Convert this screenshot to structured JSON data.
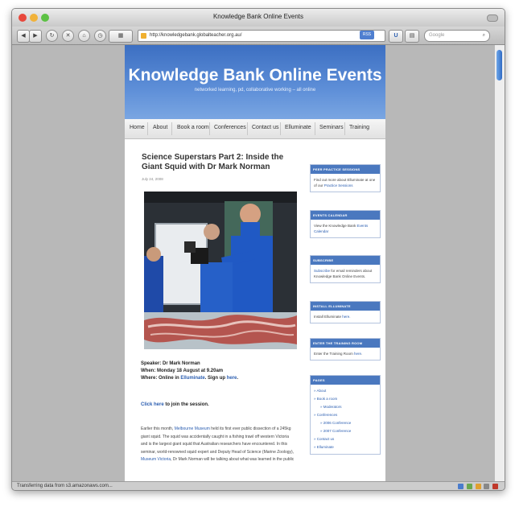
{
  "browser": {
    "window_title": "Knowledge Bank Online Events",
    "url": "http://knowledgebank.globalteacher.org.au/",
    "search_placeholder": "Google",
    "status": "Transferring data from s3.amazonaws.com...",
    "rss_label": "RSS"
  },
  "site": {
    "title": "Knowledge Bank Online Events",
    "tagline": "networked learning, pd, collaborative working – all online"
  },
  "nav": [
    "Home",
    "About",
    "Book a room",
    "Conferences",
    "Contact us",
    "Elluminate",
    "Seminars",
    "Training"
  ],
  "post": {
    "title": "Science Superstars Part 2: Inside the Giant Squid with Dr Mark Norman",
    "date": "July 24, 2008",
    "speaker": "Speaker: Dr Mark Norman",
    "when": "When:  Monday 18 August at 9.20am",
    "where_prefix": "Where:  Online in ",
    "where_link": "Elluminate",
    "where_mid": ".  Sign up ",
    "where_link2": "here",
    "where_end": ".",
    "join_link": "Click here",
    "join_text": " to join the session.",
    "body_1": "Earlier this month, ",
    "body_link1": "Melbourne Museum",
    "body_2": " held its first ever public dissection of a 245kg giant squid.  The squid was accidentally caught in a fishing trawl off western Victoria and is the largest giant squid that Australian researchers have encountered.  In this seminar, world-renowned squid expert and Deputy Head of Science (Marine Zoology), ",
    "body_link2": "Museum Victoria",
    "body_3": ", Dr Mark Norman will be talking about what was learned in the public"
  },
  "sidebar": [
    {
      "head": "PEER PRACTICE SESSIONS",
      "text": "Find out more about Elluminate at one of our ",
      "link": "Practice Sessions",
      "end": ""
    },
    {
      "head": "EVENTS CALENDAR",
      "text": "View the Knowledge Bank ",
      "link": "Events Calendar",
      "end": ""
    },
    {
      "head": "SUBSCRIBE",
      "text": "",
      "link": "Subscribe",
      "end": " for email reminders about Knowledge Bank Online Events."
    },
    {
      "head": "INSTALL ELLUMINATE",
      "text": "Install Elluminate ",
      "link": "here",
      "end": "."
    },
    {
      "head": "ENTER THE TRAINING ROOM",
      "text": "Enter the Training Room ",
      "link": "here",
      "end": "."
    }
  ],
  "pages": {
    "head": "PAGES",
    "items": [
      {
        "label": "» About",
        "sub": false
      },
      {
        "label": "» Book a room",
        "sub": false
      },
      {
        "label": "» Moderators",
        "sub": true
      },
      {
        "label": "» Conferences",
        "sub": false
      },
      {
        "label": "» 2006 Conference",
        "sub": true
      },
      {
        "label": "» 2007 Conference",
        "sub": true
      },
      {
        "label": "» Contact us",
        "sub": false
      },
      {
        "label": "» Elluminate",
        "sub": false
      }
    ]
  },
  "colors": {
    "header": "#4a7ccc",
    "sidebar_head": "#4a78bf",
    "link": "#2a5db0"
  },
  "icons": [
    "back-icon",
    "forward-icon",
    "reload-icon",
    "stop-icon",
    "home-icon",
    "rss-icon",
    "search-icon",
    "lock-icon"
  ]
}
